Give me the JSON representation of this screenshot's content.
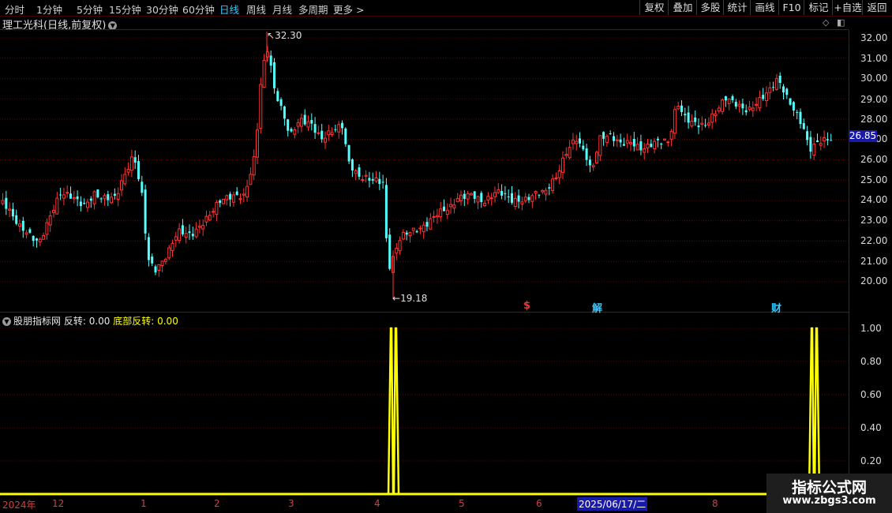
{
  "toolbar": {
    "timeframes": [
      "分时",
      "1分钟",
      "5分钟",
      "15分钟",
      "30分钟",
      "60分钟",
      "日线",
      "周线",
      "月线",
      "多周期",
      "更多"
    ],
    "active": "日线",
    "more_arrow": ">",
    "right_buttons": [
      "复权",
      "叠加",
      "多股",
      "统计",
      "画线",
      "F10",
      "标记",
      "+自选",
      "返回"
    ]
  },
  "chart_title": "理工光科(日线,前复权)",
  "price_axis": [
    "32.00",
    "31.00",
    "30.00",
    "29.00",
    "28.00",
    "27.00",
    "26.00",
    "25.00",
    "24.00",
    "23.00",
    "22.00",
    "21.00",
    "20.00"
  ],
  "current_price": "26.85",
  "high_label": "32.30",
  "low_label": "19.18",
  "markers": {
    "s": "$",
    "jie": "解",
    "cai": "财"
  },
  "indicator": {
    "name": "股朋指标网",
    "series1": "反转: 0.00",
    "series2": "底部反转: 0.00",
    "axis": [
      "1.00",
      "0.80",
      "0.60",
      "0.40",
      "0.20"
    ]
  },
  "date_axis": {
    "labels": [
      "2024年",
      "12",
      "1",
      "2",
      "3",
      "4",
      "5",
      "6",
      "7",
      "8"
    ],
    "selected": "2025/06/17/二"
  },
  "watermark": {
    "line1": "指标公式网",
    "line2": "www.zbgs3.com"
  },
  "colors": {
    "up": "#ff3232",
    "down": "#54ffff",
    "grid": "#8b0000",
    "signal": "#ffff00"
  },
  "chart_data": {
    "type": "candlestick",
    "price_range": [
      19.18,
      32.3
    ],
    "high": 32.3,
    "low": 19.18,
    "last": 26.85,
    "indicator_series": [
      {
        "name": "底部反转",
        "spikes_at": [
          "2025/04 (early)",
          "2025/08 (late)"
        ],
        "spike_value": 1.0,
        "baseline": 0.0
      }
    ]
  }
}
